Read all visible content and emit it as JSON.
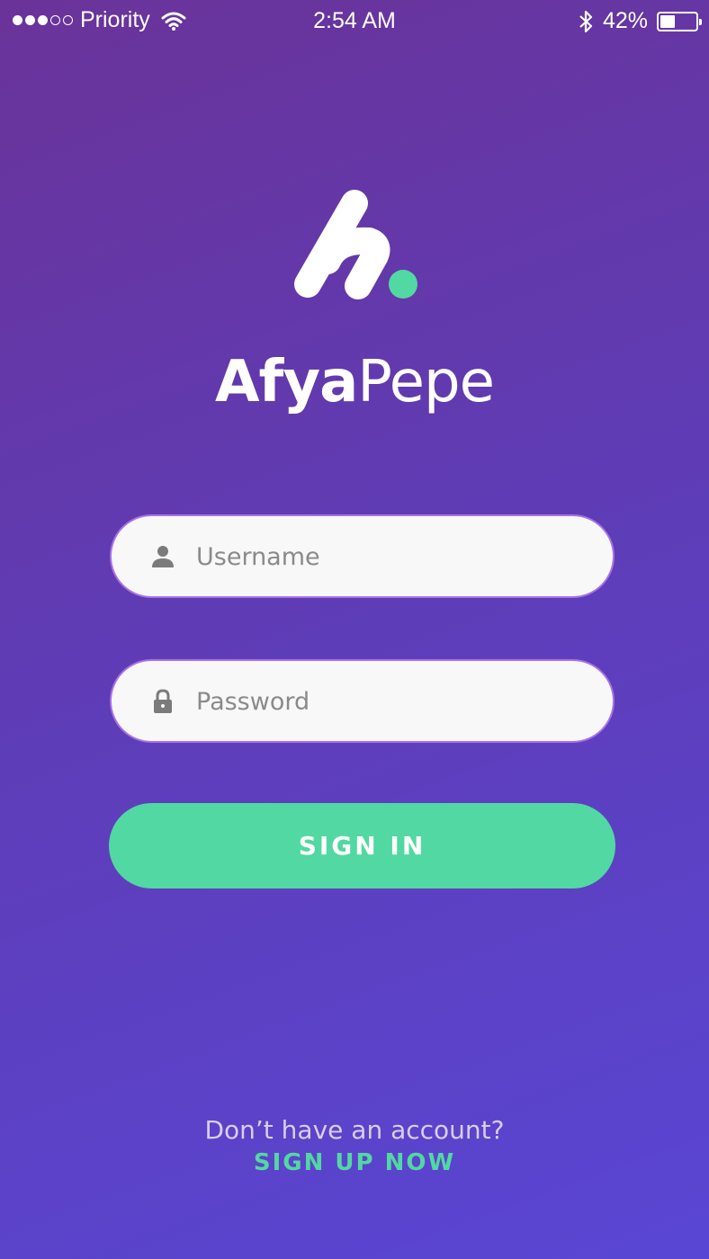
{
  "status_bar": {
    "carrier": "Priority",
    "signal_bars_filled": 3,
    "signal_bars_total": 5,
    "time": "2:54 AM",
    "battery_percent_label": "42%",
    "battery_level": 0.42
  },
  "brand": {
    "name_bold": "Afya",
    "name_regular": "Pepe",
    "accent_color": "#52d8a2"
  },
  "login_form": {
    "username": {
      "placeholder": "Username",
      "value": "",
      "icon": "user-icon"
    },
    "password": {
      "placeholder": "Password",
      "value": "",
      "icon": "lock-icon"
    },
    "sign_in_label": "SIGN IN"
  },
  "footer": {
    "prompt": "Don’t have an account?",
    "signup_label": "SIGN UP NOW"
  },
  "colors": {
    "background_top": "#6a3399",
    "background_bottom": "#5946d4",
    "input_border": "#a872e8",
    "button": "#52d8a2"
  }
}
